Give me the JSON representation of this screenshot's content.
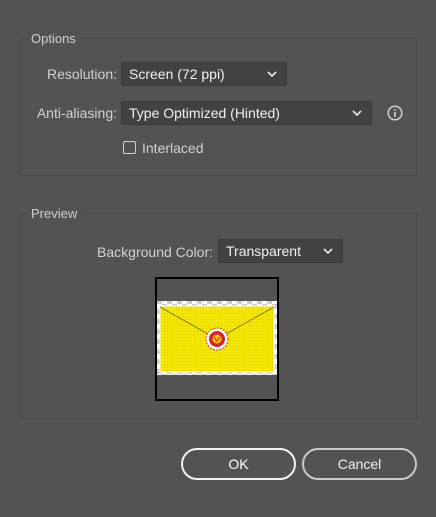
{
  "options": {
    "title": "Options",
    "resolution_label": "Resolution:",
    "resolution_value": "Screen (72 ppi)",
    "antialias_label": "Anti-aliasing:",
    "antialias_value": "Type Optimized (Hinted)",
    "interlaced_label": "Interlaced",
    "interlaced_checked": false
  },
  "preview": {
    "title": "Preview",
    "bg_color_label": "Background Color:",
    "bg_color_value": "Transparent",
    "envelope_color": "#f5e800",
    "seal_color": "#d8242c"
  },
  "buttons": {
    "ok": "OK",
    "cancel": "Cancel"
  },
  "icons": {
    "info": "info-icon",
    "dropdown": "chevron-down-icon",
    "checkbox": "checkbox-icon"
  },
  "colors": {
    "dialog_bg": "#535353",
    "field_bg": "#424242",
    "text": "#d2d2d2"
  }
}
